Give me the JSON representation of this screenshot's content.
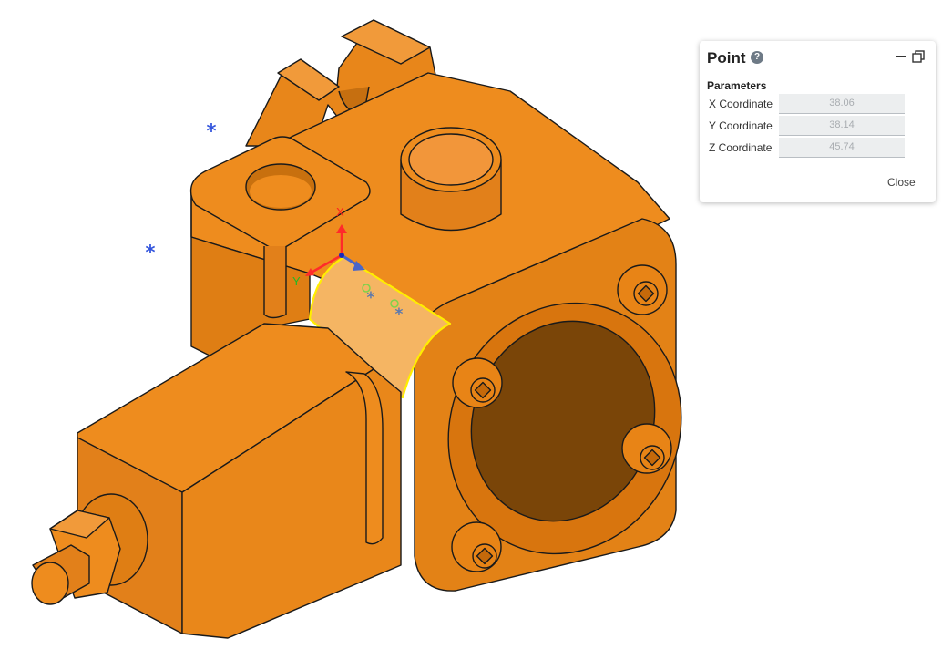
{
  "point_panel": {
    "title": "Point",
    "help_icon": "?",
    "section": "Parameters",
    "fields": [
      {
        "label": "X Coordinate",
        "value": "38.06"
      },
      {
        "label": "Y Coordinate",
        "value": "38.14"
      },
      {
        "label": "Z Coordinate",
        "value": "45.74"
      }
    ],
    "close_label": "Close"
  },
  "viewport": {
    "triad_x": "X",
    "triad_y": "Y",
    "colors": {
      "part": "#EE8A1C",
      "part_dark": "#7A4508",
      "selected_face": "#F5B563",
      "selection_edge": "#FFEE00",
      "point_marker": "#3355DD"
    }
  }
}
